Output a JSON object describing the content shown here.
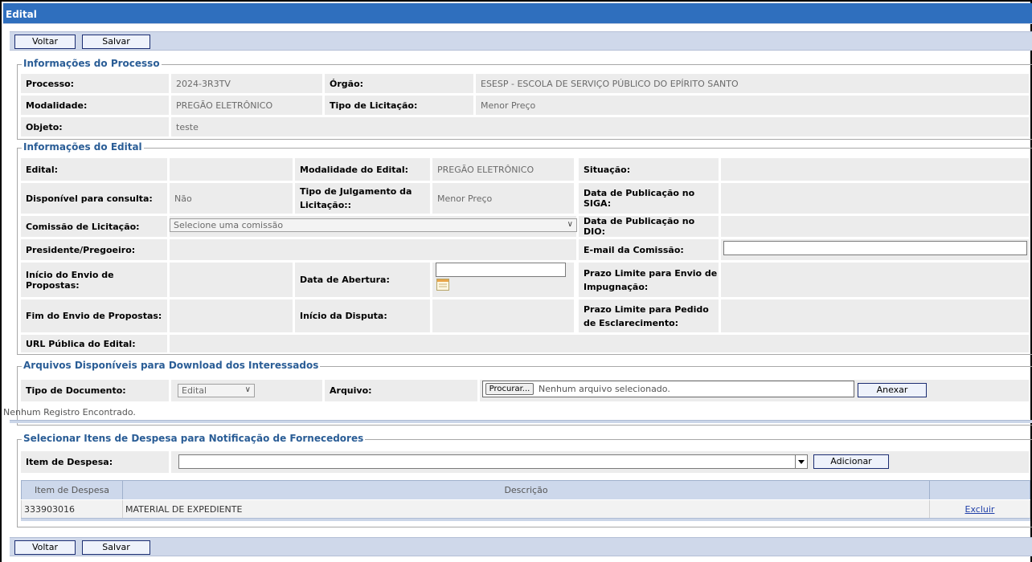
{
  "window": {
    "title": "Edital"
  },
  "buttons": {
    "back": "Voltar",
    "save": "Salvar"
  },
  "processo": {
    "legend": "Informações do Processo",
    "processo_label": "Processo:",
    "processo_value": "2024-3R3TV",
    "orgao_label": "Órgão:",
    "orgao_value": "ESESP - ESCOLA DE SERVIÇO PÚBLICO DO EPÍRITO SANTO",
    "modalidade_label": "Modalidade:",
    "modalidade_value": "PREGÃO ELETRÔNICO",
    "tipo_label": "Tipo de Licitação:",
    "tipo_value": "Menor Preço",
    "objeto_label": "Objeto:",
    "objeto_value": "teste"
  },
  "edital": {
    "legend": "Informações do Edital",
    "edital_label": "Edital:",
    "edital_value": "",
    "modalidade_label": "Modalidade do Edital:",
    "modalidade_value": "PREGÃO ELETRÔNICO",
    "situacao_label": "Situação:",
    "situacao_value": "",
    "disponivel_label": "Disponível para consulta:",
    "disponivel_value": "Não",
    "julgamento_label": "Tipo de Julgamento da Licitação::",
    "julgamento_value": "Menor Preço",
    "pub_siga_label": "Data de Publicação no SIGA:",
    "comissao_label": "Comissão de Licitação:",
    "comissao_selected": "Selecione uma comissão",
    "pub_dio_label": "Data de Publicação no DIO:",
    "presidente_label": "Presidente/Pregoeiro:",
    "email_label": "E-mail da Comissão:",
    "email_value": "",
    "inicio_envio_label": "Início do Envio de Propostas:",
    "data_abertura_label": "Data de Abertura:",
    "data_abertura_value": "",
    "prazo_impugnacao_label": "Prazo Limite para Envio de Impugnação:",
    "fim_envio_label": "Fim do Envio de Propostas:",
    "inicio_disputa_label": "Início da Disputa:",
    "prazo_esclarecimento_label": "Prazo Limite para Pedido de Esclarecimento:",
    "url_label": "URL Pública do Edital:"
  },
  "arquivos": {
    "legend": "Arquivos Disponíveis para Download dos Interessados",
    "tipo_label": "Tipo de Documento:",
    "tipo_selected": "Edital",
    "arquivo_label": "Arquivo:",
    "browse_button": "Procurar...",
    "no_file": "Nenhum arquivo selecionado.",
    "attach_button": "Anexar",
    "empty_message": "Nenhum Registro Encontrado."
  },
  "despesa": {
    "legend": "Selecionar Itens de Despesa para Notificação de Fornecedores",
    "item_label": "Item de Despesa:",
    "item_value": "",
    "add_button": "Adicionar",
    "columns": [
      "Item de Despesa",
      "Descrição",
      ""
    ],
    "rows": [
      {
        "code": "333903016",
        "description": "MATERIAL DE EXPEDIENTE",
        "action": "Excluir"
      }
    ]
  }
}
